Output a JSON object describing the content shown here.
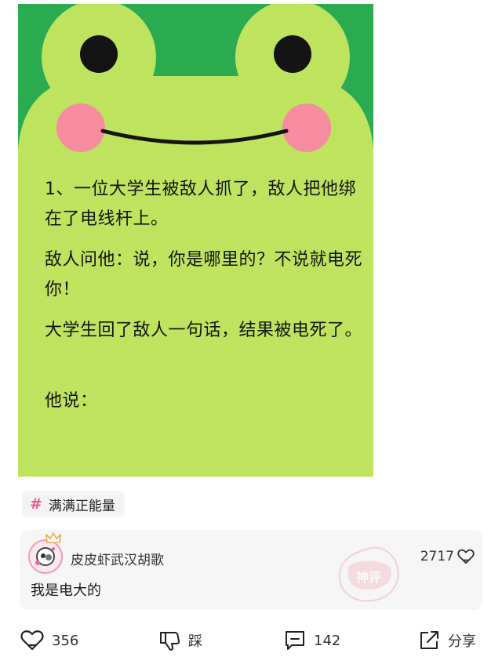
{
  "post": {
    "joke_lines": [
      "1、一位大学生被敌人抓了，敌人把他绑在了电线杆上。",
      "敌人问他：说，你是哪里的？不说就电死你！",
      "大学生回了敌人一句话，结果被电死了。",
      "他说："
    ]
  },
  "topic": {
    "icon": "hash-icon",
    "label": "满满正能量"
  },
  "god_comment": {
    "username": "皮皮虾武汉胡歌",
    "text": "我是电大的",
    "like_count": "2717",
    "stamp_text": "神评"
  },
  "actions": {
    "like_count": "356",
    "dislike_label": "踩",
    "comment_count": "142",
    "share_label": "分享"
  },
  "colors": {
    "frog_green": "#bde35f",
    "bg_green": "#2bab4f",
    "cheek_pink": "#f78c9e",
    "accent_pink": "#ef5b86"
  }
}
